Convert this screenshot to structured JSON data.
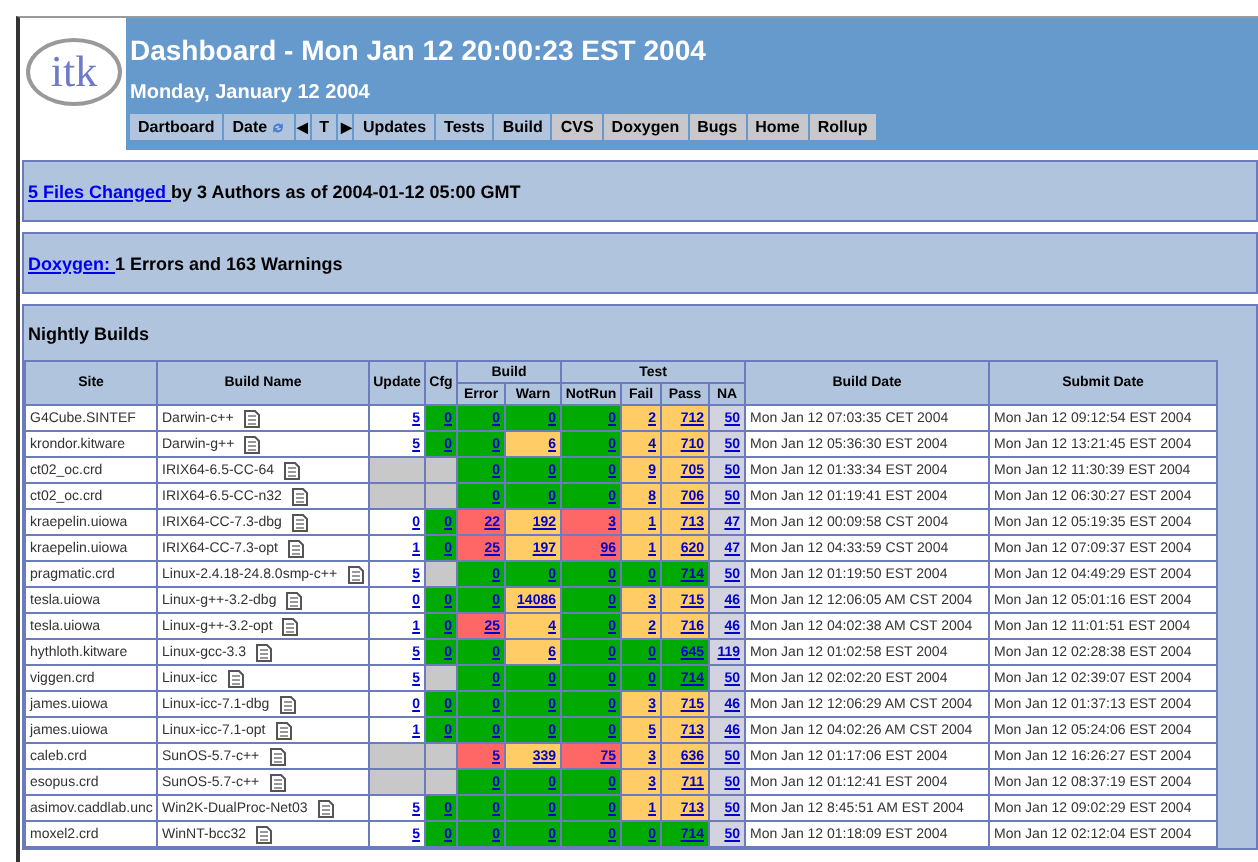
{
  "logo": {
    "text": "itk"
  },
  "header": {
    "title": "Dashboard - Mon Jan 12 20:00:23 EST 2004",
    "date": "Monday, January 12 2004"
  },
  "nav": [
    {
      "label": "Dartboard",
      "kind": "page"
    },
    {
      "label": "Date",
      "kind": "date"
    },
    {
      "label": "◀",
      "kind": "arrow"
    },
    {
      "label": "T",
      "kind": "page"
    },
    {
      "label": "▶",
      "kind": "arrow"
    },
    {
      "label": "Updates",
      "kind": "page"
    },
    {
      "label": "Tests",
      "kind": "page"
    },
    {
      "label": "Build",
      "kind": "page"
    },
    {
      "label": "CVS",
      "kind": "external"
    },
    {
      "label": "Doxygen",
      "kind": "external"
    },
    {
      "label": "Bugs",
      "kind": "external"
    },
    {
      "label": "Home",
      "kind": "external"
    },
    {
      "label": "Rollup",
      "kind": "external"
    }
  ],
  "updates_banner": {
    "link": "5 Files Changed ",
    "text": "by 3 Authors as of 2004-01-12 05:00 GMT"
  },
  "doxygen_banner": {
    "link": "Doxygen: ",
    "text": "1 Errors and 163 Warnings"
  },
  "nightly": {
    "title": "Nightly Builds",
    "columns": {
      "site": "Site",
      "build_name": "Build Name",
      "update": "Update",
      "cfg": "Cfg",
      "build": "Build",
      "error": "Error",
      "warn": "Warn",
      "test": "Test",
      "not_run": "NotRun",
      "fail": "Fail",
      "pass": "Pass",
      "na": "NA",
      "build_date": "Build Date",
      "submit_date": "Submit Date"
    },
    "rows": [
      {
        "site": "G4Cube.SINTEF",
        "build_name": "Darwin-c++",
        "update": {
          "value": "5",
          "color": "#ffffff"
        },
        "cfg": {
          "value": "0",
          "color": "#00aa00"
        },
        "error": {
          "value": "0",
          "color": "#00aa00"
        },
        "warn": {
          "value": "0",
          "color": "#00aa00"
        },
        "not_run": {
          "value": "0",
          "color": "#00aa00"
        },
        "fail": {
          "value": "2",
          "color": "#ffcc66"
        },
        "pass": {
          "value": "712",
          "color": "#ffcc66"
        },
        "na": {
          "value": "50",
          "color": "#d3d3df"
        },
        "build_date": "Mon Jan 12 07:03:35 CET 2004",
        "submit_date": "Mon Jan 12 09:12:54 EST 2004"
      },
      {
        "site": "krondor.kitware",
        "build_name": "Darwin-g++",
        "update": {
          "value": "5",
          "color": "#ffffff"
        },
        "cfg": {
          "value": "0",
          "color": "#00aa00"
        },
        "error": {
          "value": "0",
          "color": "#00aa00"
        },
        "warn": {
          "value": "6",
          "color": "#ffcc66"
        },
        "not_run": {
          "value": "0",
          "color": "#00aa00"
        },
        "fail": {
          "value": "4",
          "color": "#ffcc66"
        },
        "pass": {
          "value": "710",
          "color": "#ffcc66"
        },
        "na": {
          "value": "50",
          "color": "#d3d3df"
        },
        "build_date": "Mon Jan 12 05:36:30 EST 2004",
        "submit_date": "Mon Jan 12 13:21:45 EST 2004"
      },
      {
        "site": "ct02_oc.crd",
        "build_name": "IRIX64-6.5-CC-64",
        "update": {
          "color": "#c8c8c8"
        },
        "cfg": {
          "color": "#c8c8c8"
        },
        "error": {
          "value": "0",
          "color": "#00aa00"
        },
        "warn": {
          "value": "0",
          "color": "#00aa00"
        },
        "not_run": {
          "value": "0",
          "color": "#00aa00"
        },
        "fail": {
          "value": "9",
          "color": "#ffcc66"
        },
        "pass": {
          "value": "705",
          "color": "#ffcc66"
        },
        "na": {
          "value": "50",
          "color": "#d3d3df"
        },
        "build_date": "Mon Jan 12 01:33:34 EST 2004",
        "submit_date": "Mon Jan 12 11:30:39 EST 2004"
      },
      {
        "site": "ct02_oc.crd",
        "build_name": "IRIX64-6.5-CC-n32",
        "update": {
          "color": "#c8c8c8"
        },
        "cfg": {
          "color": "#c8c8c8"
        },
        "error": {
          "value": "0",
          "color": "#00aa00"
        },
        "warn": {
          "value": "0",
          "color": "#00aa00"
        },
        "not_run": {
          "value": "0",
          "color": "#00aa00"
        },
        "fail": {
          "value": "8",
          "color": "#ffcc66"
        },
        "pass": {
          "value": "706",
          "color": "#ffcc66"
        },
        "na": {
          "value": "50",
          "color": "#d3d3df"
        },
        "build_date": "Mon Jan 12 01:19:41 EST 2004",
        "submit_date": "Mon Jan 12 06:30:27 EST 2004"
      },
      {
        "site": "kraepelin.uiowa",
        "build_name": "IRIX64-CC-7.3-dbg",
        "update": {
          "value": "0",
          "color": "#ffffff"
        },
        "cfg": {
          "value": "0",
          "color": "#00aa00"
        },
        "error": {
          "value": "22",
          "color": "#ff6666"
        },
        "warn": {
          "value": "192",
          "color": "#ffcc66"
        },
        "not_run": {
          "value": "3",
          "color": "#ff6666"
        },
        "fail": {
          "value": "1",
          "color": "#ffcc66"
        },
        "pass": {
          "value": "713",
          "color": "#ffcc66"
        },
        "na": {
          "value": "47",
          "color": "#d3d3df"
        },
        "build_date": "Mon Jan 12 00:09:58 CST 2004",
        "submit_date": "Mon Jan 12 05:19:35 EST 2004"
      },
      {
        "site": "kraepelin.uiowa",
        "build_name": "IRIX64-CC-7.3-opt",
        "update": {
          "value": "1",
          "color": "#ffffff"
        },
        "cfg": {
          "value": "0",
          "color": "#00aa00"
        },
        "error": {
          "value": "25",
          "color": "#ff6666"
        },
        "warn": {
          "value": "197",
          "color": "#ffcc66"
        },
        "not_run": {
          "value": "96",
          "color": "#ff6666"
        },
        "fail": {
          "value": "1",
          "color": "#ffcc66"
        },
        "pass": {
          "value": "620",
          "color": "#ffcc66"
        },
        "na": {
          "value": "47",
          "color": "#d3d3df"
        },
        "build_date": "Mon Jan 12 04:33:59 CST 2004",
        "submit_date": "Mon Jan 12 07:09:37 EST 2004"
      },
      {
        "site": "pragmatic.crd",
        "build_name": "Linux-2.4.18-24.8.0smp-c++",
        "update": {
          "value": "5",
          "color": "#ffffff"
        },
        "cfg": {
          "color": "#c8c8c8"
        },
        "error": {
          "value": "0",
          "color": "#00aa00"
        },
        "warn": {
          "value": "0",
          "color": "#00aa00"
        },
        "not_run": {
          "value": "0",
          "color": "#00aa00"
        },
        "fail": {
          "value": "0",
          "color": "#00aa00"
        },
        "pass": {
          "value": "714",
          "color": "#00aa00"
        },
        "na": {
          "value": "50",
          "color": "#d3d3df"
        },
        "build_date": "Mon Jan 12 01:19:50 EST 2004",
        "submit_date": "Mon Jan 12 04:49:29 EST 2004"
      },
      {
        "site": "tesla.uiowa",
        "build_name": "Linux-g++-3.2-dbg",
        "update": {
          "value": "0",
          "color": "#ffffff"
        },
        "cfg": {
          "value": "0",
          "color": "#00aa00"
        },
        "error": {
          "value": "0",
          "color": "#00aa00"
        },
        "warn": {
          "value": "14086",
          "color": "#ffcc66"
        },
        "not_run": {
          "value": "0",
          "color": "#00aa00"
        },
        "fail": {
          "value": "3",
          "color": "#ffcc66"
        },
        "pass": {
          "value": "715",
          "color": "#ffcc66"
        },
        "na": {
          "value": "46",
          "color": "#d3d3df"
        },
        "build_date": "Mon Jan 12 12:06:05 AM CST 2004",
        "submit_date": "Mon Jan 12 05:01:16 EST 2004"
      },
      {
        "site": "tesla.uiowa",
        "build_name": "Linux-g++-3.2-opt",
        "update": {
          "value": "1",
          "color": "#ffffff"
        },
        "cfg": {
          "value": "0",
          "color": "#00aa00"
        },
        "error": {
          "value": "25",
          "color": "#ff6666"
        },
        "warn": {
          "value": "4",
          "color": "#ffcc66"
        },
        "not_run": {
          "value": "0",
          "color": "#00aa00"
        },
        "fail": {
          "value": "2",
          "color": "#ffcc66"
        },
        "pass": {
          "value": "716",
          "color": "#ffcc66"
        },
        "na": {
          "value": "46",
          "color": "#d3d3df"
        },
        "build_date": "Mon Jan 12 04:02:38 AM CST 2004",
        "submit_date": "Mon Jan 12 11:01:51 EST 2004"
      },
      {
        "site": "hythloth.kitware",
        "build_name": "Linux-gcc-3.3",
        "update": {
          "value": "5",
          "color": "#ffffff"
        },
        "cfg": {
          "value": "0",
          "color": "#00aa00"
        },
        "error": {
          "value": "0",
          "color": "#00aa00"
        },
        "warn": {
          "value": "6",
          "color": "#ffcc66"
        },
        "not_run": {
          "value": "0",
          "color": "#00aa00"
        },
        "fail": {
          "value": "0",
          "color": "#00aa00"
        },
        "pass": {
          "value": "645",
          "color": "#00aa00"
        },
        "na": {
          "value": "119",
          "color": "#d3d3df"
        },
        "build_date": "Mon Jan 12 01:02:58 EST 2004",
        "submit_date": "Mon Jan 12 02:28:38 EST 2004"
      },
      {
        "site": "viggen.crd",
        "build_name": "Linux-icc",
        "update": {
          "value": "5",
          "color": "#ffffff"
        },
        "cfg": {
          "color": "#c8c8c8"
        },
        "error": {
          "value": "0",
          "color": "#00aa00"
        },
        "warn": {
          "value": "0",
          "color": "#00aa00"
        },
        "not_run": {
          "value": "0",
          "color": "#00aa00"
        },
        "fail": {
          "value": "0",
          "color": "#00aa00"
        },
        "pass": {
          "value": "714",
          "color": "#00aa00"
        },
        "na": {
          "value": "50",
          "color": "#d3d3df"
        },
        "build_date": "Mon Jan 12 02:02:20 EST 2004",
        "submit_date": "Mon Jan 12 02:39:07 EST 2004"
      },
      {
        "site": "james.uiowa",
        "build_name": "Linux-icc-7.1-dbg",
        "update": {
          "value": "0",
          "color": "#ffffff"
        },
        "cfg": {
          "value": "0",
          "color": "#00aa00"
        },
        "error": {
          "value": "0",
          "color": "#00aa00"
        },
        "warn": {
          "value": "0",
          "color": "#00aa00"
        },
        "not_run": {
          "value": "0",
          "color": "#00aa00"
        },
        "fail": {
          "value": "3",
          "color": "#ffcc66"
        },
        "pass": {
          "value": "715",
          "color": "#ffcc66"
        },
        "na": {
          "value": "46",
          "color": "#d3d3df"
        },
        "build_date": "Mon Jan 12 12:06:29 AM CST 2004",
        "submit_date": "Mon Jan 12 01:37:13 EST 2004"
      },
      {
        "site": "james.uiowa",
        "build_name": "Linux-icc-7.1-opt",
        "update": {
          "value": "1",
          "color": "#ffffff"
        },
        "cfg": {
          "value": "0",
          "color": "#00aa00"
        },
        "error": {
          "value": "0",
          "color": "#00aa00"
        },
        "warn": {
          "value": "0",
          "color": "#00aa00"
        },
        "not_run": {
          "value": "0",
          "color": "#00aa00"
        },
        "fail": {
          "value": "5",
          "color": "#ffcc66"
        },
        "pass": {
          "value": "713",
          "color": "#ffcc66"
        },
        "na": {
          "value": "46",
          "color": "#d3d3df"
        },
        "build_date": "Mon Jan 12 04:02:26 AM CST 2004",
        "submit_date": "Mon Jan 12 05:24:06 EST 2004"
      },
      {
        "site": "caleb.crd",
        "build_name": "SunOS-5.7-c++",
        "update": {
          "color": "#c8c8c8"
        },
        "cfg": {
          "color": "#c8c8c8"
        },
        "error": {
          "value": "5",
          "color": "#ff6666"
        },
        "warn": {
          "value": "339",
          "color": "#ffcc66"
        },
        "not_run": {
          "value": "75",
          "color": "#ff6666"
        },
        "fail": {
          "value": "3",
          "color": "#ffcc66"
        },
        "pass": {
          "value": "636",
          "color": "#ffcc66"
        },
        "na": {
          "value": "50",
          "color": "#d3d3df"
        },
        "build_date": "Mon Jan 12 01:17:06 EST 2004",
        "submit_date": "Mon Jan 12 16:26:27 EST 2004"
      },
      {
        "site": "esopus.crd",
        "build_name": "SunOS-5.7-c++",
        "update": {
          "color": "#c8c8c8"
        },
        "cfg": {
          "color": "#c8c8c8"
        },
        "error": {
          "value": "0",
          "color": "#00aa00"
        },
        "warn": {
          "value": "0",
          "color": "#00aa00"
        },
        "not_run": {
          "value": "0",
          "color": "#00aa00"
        },
        "fail": {
          "value": "3",
          "color": "#ffcc66"
        },
        "pass": {
          "value": "711",
          "color": "#ffcc66"
        },
        "na": {
          "value": "50",
          "color": "#d3d3df"
        },
        "build_date": "Mon Jan 12 01:12:41 EST 2004",
        "submit_date": "Mon Jan 12 08:37:19 EST 2004"
      },
      {
        "site": "asimov.caddlab.unc",
        "build_name": "Win2K-DualProc-Net03",
        "update": {
          "value": "5",
          "color": "#ffffff"
        },
        "cfg": {
          "value": "0",
          "color": "#00aa00"
        },
        "error": {
          "value": "0",
          "color": "#00aa00"
        },
        "warn": {
          "value": "0",
          "color": "#00aa00"
        },
        "not_run": {
          "value": "0",
          "color": "#00aa00"
        },
        "fail": {
          "value": "1",
          "color": "#ffcc66"
        },
        "pass": {
          "value": "713",
          "color": "#ffcc66"
        },
        "na": {
          "value": "50",
          "color": "#d3d3df"
        },
        "build_date": "Mon Jan 12 8:45:51 AM EST 2004",
        "submit_date": "Mon Jan 12 09:02:29 EST 2004"
      },
      {
        "site": "moxel2.crd",
        "build_name": "WinNT-bcc32",
        "update": {
          "value": "5",
          "color": "#ffffff"
        },
        "cfg": {
          "value": "0",
          "color": "#00aa00"
        },
        "error": {
          "value": "0",
          "color": "#00aa00"
        },
        "warn": {
          "value": "0",
          "color": "#00aa00"
        },
        "not_run": {
          "value": "0",
          "color": "#00aa00"
        },
        "fail": {
          "value": "0",
          "color": "#00aa00"
        },
        "pass": {
          "value": "714",
          "color": "#00aa00"
        },
        "na": {
          "value": "50",
          "color": "#d3d3df"
        },
        "build_date": "Mon Jan 12 01:18:09 EST 2004",
        "submit_date": "Mon Jan 12 02:12:04 EST 2004"
      }
    ]
  }
}
